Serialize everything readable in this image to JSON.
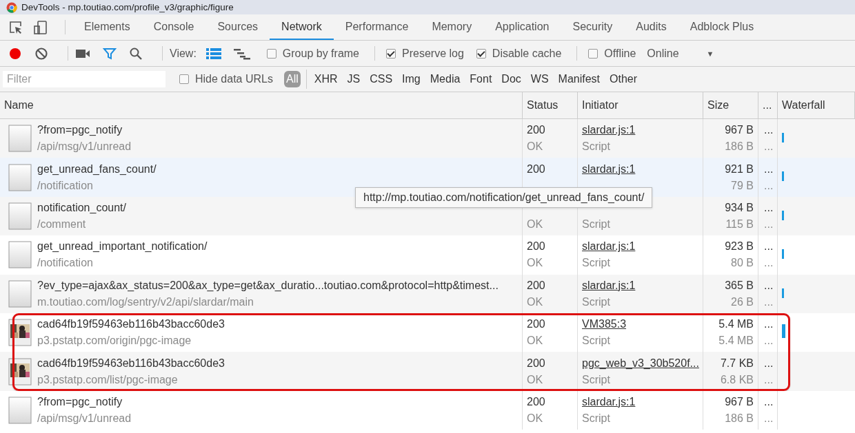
{
  "window": {
    "title": "DevTools - mp.toutiao.com/profile_v3/graphic/figure"
  },
  "tabs": [
    {
      "label": "Elements",
      "selected": false
    },
    {
      "label": "Console",
      "selected": false
    },
    {
      "label": "Sources",
      "selected": false
    },
    {
      "label": "Network",
      "selected": true
    },
    {
      "label": "Performance",
      "selected": false
    },
    {
      "label": "Memory",
      "selected": false
    },
    {
      "label": "Application",
      "selected": false
    },
    {
      "label": "Security",
      "selected": false
    },
    {
      "label": "Audits",
      "selected": false
    },
    {
      "label": "Adblock Plus",
      "selected": false
    }
  ],
  "toolbar": {
    "recording": true,
    "filter_on": true,
    "view_label": "View:",
    "large_rows": true,
    "group_by_frame": {
      "label": "Group by frame",
      "checked": false
    },
    "preserve_log": {
      "label": "Preserve log",
      "checked": true
    },
    "disable_cache": {
      "label": "Disable cache",
      "checked": true
    },
    "offline": {
      "label": "Offline",
      "checked": false
    },
    "throttling": "Online",
    "throttling_caret": "▼"
  },
  "filter_bar": {
    "placeholder": "Filter",
    "hide_data_urls": {
      "label": "Hide data URLs",
      "checked": false
    },
    "types": [
      {
        "label": "All",
        "selected": true
      },
      {
        "label": "XHR",
        "selected": false
      },
      {
        "label": "JS",
        "selected": false
      },
      {
        "label": "CSS",
        "selected": false
      },
      {
        "label": "Img",
        "selected": false
      },
      {
        "label": "Media",
        "selected": false
      },
      {
        "label": "Font",
        "selected": false
      },
      {
        "label": "Doc",
        "selected": false
      },
      {
        "label": "WS",
        "selected": false
      },
      {
        "label": "Manifest",
        "selected": false
      },
      {
        "label": "Other",
        "selected": false
      }
    ]
  },
  "table": {
    "columns": [
      "Name",
      "Status",
      "Initiator",
      "Size",
      "...",
      "Waterfall"
    ],
    "rows": [
      {
        "kind": "document",
        "name": "?from=pgc_notify",
        "path": "/api/msg/v1/unread",
        "status": "200",
        "status_text": "OK",
        "initiator": "slardar.js:1",
        "initiator_type": "Script",
        "size": "967 B",
        "resource_size": "186 B",
        "more": "...",
        "more_2": "...",
        "highlighted": false
      },
      {
        "kind": "document",
        "name": "get_unread_fans_count/",
        "path": "/notification",
        "status": "200",
        "initiator": "slardar.js:1",
        "size": "921 B",
        "resource_size": "79 B",
        "more": "...",
        "more_2": "...",
        "hovered": true,
        "highlighted": false
      },
      {
        "kind": "document",
        "name": "notification_count/",
        "path": "/comment",
        "status_text": "OK",
        "initiator_type": "Script",
        "size": "934 B",
        "resource_size": "115 B",
        "more": "...",
        "more_2": "...",
        "highlighted": false
      },
      {
        "kind": "document",
        "name": "get_unread_important_notification/",
        "path": "/notification",
        "status": "200",
        "status_text": "OK",
        "initiator": "slardar.js:1",
        "initiator_type": "Script",
        "size": "923 B",
        "resource_size": "80 B",
        "more": "...",
        "more_2": "...",
        "highlighted": false
      },
      {
        "kind": "document",
        "name": "?ev_type=ajax&ax_status=200&ax_type=get&ax_duratio...toutiao.com&protocol=http&timest...",
        "path": "m.toutiao.com/log/sentry/v2/api/slardar/main",
        "status": "200",
        "status_text": "OK",
        "initiator": "slardar.js:1",
        "initiator_type": "Script",
        "size": "365 B",
        "resource_size": "26 B",
        "more": "...",
        "more_2": "...",
        "highlighted": false
      },
      {
        "name": "cad64fb19f59463eb116b43bacc60de3",
        "path": "p3.pstatp.com/origin/pgc-image",
        "status": "200",
        "status_text": "OK",
        "initiator": "VM385:3",
        "initiator_type": "Script",
        "size": "5.4 MB",
        "resource_size": "5.4 MB",
        "more": "...",
        "more_2": "...",
        "highlighted": true
      },
      {
        "name": "cad64fb19f59463eb116b43bacc60de3",
        "path": "p3.pstatp.com/list/pgc-image",
        "status": "200",
        "status_text": "OK",
        "initiator": "pgc_web_v3_30b520f...",
        "initiator_type": "Script",
        "size": "7.7 KB",
        "resource_size": "6.8 KB",
        "more": "...",
        "more_2": "...",
        "highlighted": true
      },
      {
        "kind": "document",
        "name": "?from=pgc_notify",
        "path": "/api/msg/v1/unread",
        "status": "200",
        "status_text": "OK",
        "initiator": "slardar.js:1",
        "initiator_type": "Script",
        "size": "967 B",
        "resource_size": "186 B",
        "more": "...",
        "more_2": "...",
        "highlighted": false
      }
    ]
  },
  "tooltip": {
    "text": "http://mp.toutiao.com/notification/get_unread_fans_count/"
  }
}
